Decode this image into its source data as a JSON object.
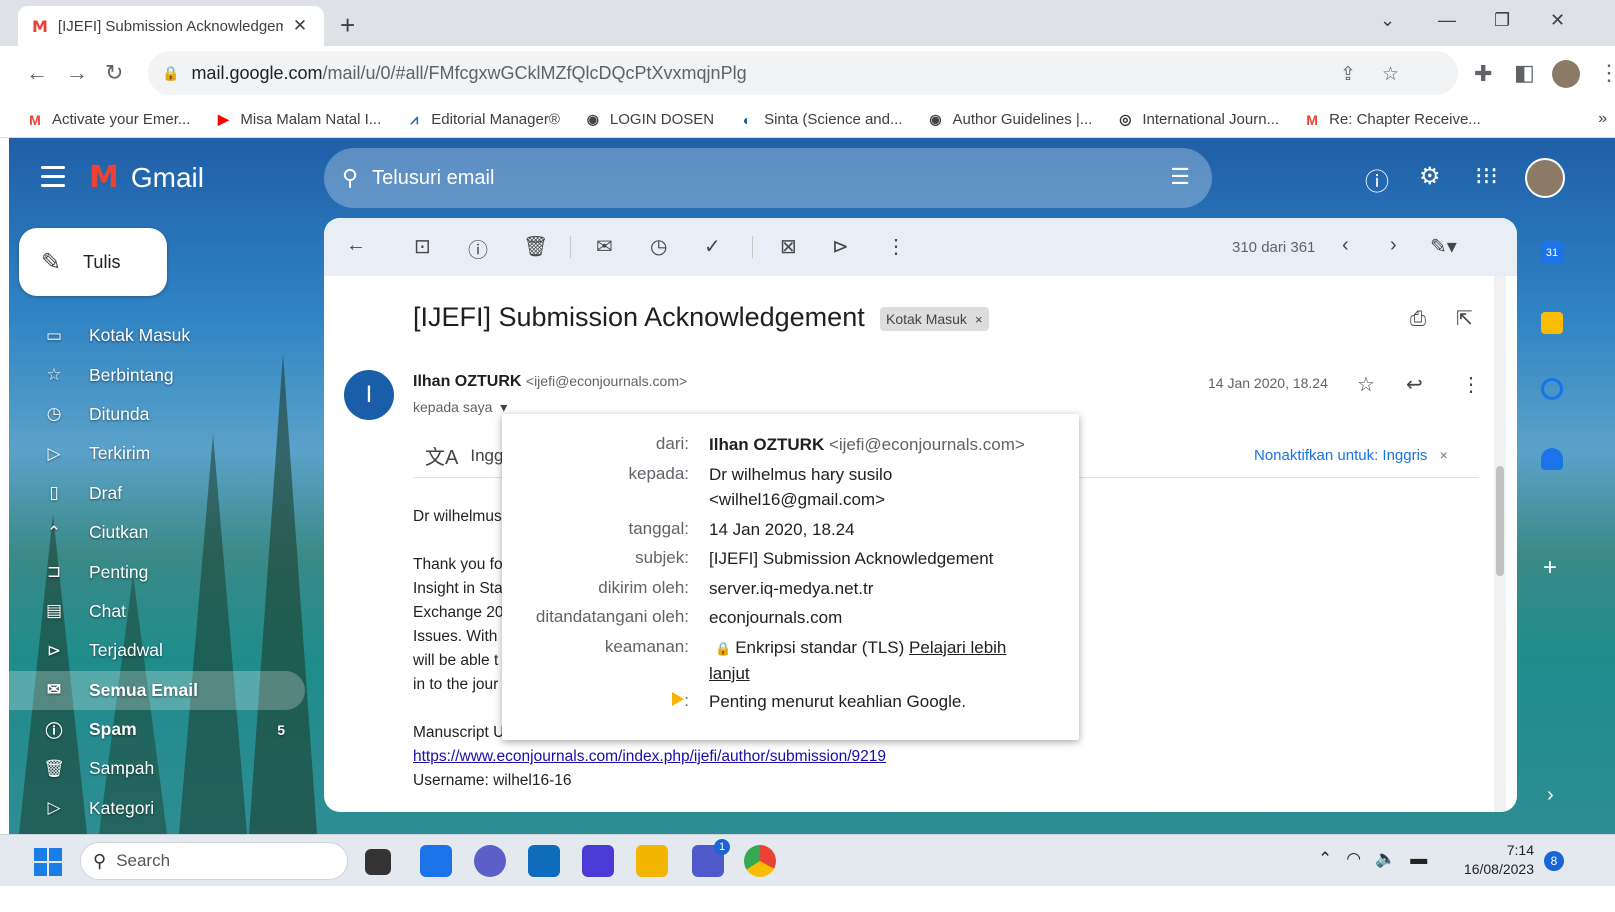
{
  "browser": {
    "tab_title": "[IJEFI] Submission Acknowledgement",
    "tab_close": "✕",
    "new_tab": "+",
    "url_host": "mail.google.com",
    "url_path": "/mail/u/0/#all/FMfcgxwGCklMZfQlcDQcPtXvxmqjnPlg",
    "bookmarks": [
      {
        "label": "Activate your Emer...",
        "icon": "gmail-icon"
      },
      {
        "label": "Misa Malam Natal I...",
        "icon": "youtube-icon"
      },
      {
        "label": "Editorial Manager®",
        "icon": "editorial-manager-icon"
      },
      {
        "label": "LOGIN DOSEN",
        "icon": "globe-icon"
      },
      {
        "label": "Sinta (Science and...",
        "icon": "sinta-icon"
      },
      {
        "label": "Author Guidelines |...",
        "icon": "globe-icon"
      },
      {
        "label": "International Journ...",
        "icon": "circle-icon"
      },
      {
        "label": "Re: Chapter Receive...",
        "icon": "gmail-icon"
      }
    ],
    "bookmarks_overflow": "»"
  },
  "gmail": {
    "brand": "Gmail",
    "search_placeholder": "Telusuri email",
    "compose_label": "Tulis",
    "nav": [
      {
        "label": "Kotak Masuk",
        "icon": "inbox-icon",
        "glyph": "▭"
      },
      {
        "label": "Berbintang",
        "icon": "star-icon",
        "glyph": "☆"
      },
      {
        "label": "Ditunda",
        "icon": "clock-icon",
        "glyph": "◷"
      },
      {
        "label": "Terkirim",
        "icon": "send-icon",
        "glyph": "▷"
      },
      {
        "label": "Draf",
        "icon": "draft-icon",
        "glyph": "▯"
      },
      {
        "label": "Ciutkan",
        "icon": "chevron-up-icon",
        "glyph": "⌃"
      },
      {
        "label": "Penting",
        "icon": "important-icon",
        "glyph": "⊐"
      },
      {
        "label": "Chat",
        "icon": "chat-icon",
        "glyph": "▤"
      },
      {
        "label": "Terjadwal",
        "icon": "scheduled-icon",
        "glyph": "⊳"
      },
      {
        "label": "Semua Email",
        "icon": "all-mail-icon",
        "glyph": "✉"
      },
      {
        "label": "Spam",
        "icon": "spam-icon",
        "glyph": "ⓘ",
        "count": "5"
      },
      {
        "label": "Sampah",
        "icon": "trash-icon",
        "glyph": "🗑"
      },
      {
        "label": "Kategori",
        "icon": "label-icon",
        "glyph": "▷"
      }
    ],
    "message_count": "310 dari 361",
    "subject": "[IJEFI] Submission Acknowledgement",
    "label_chip": "Kotak Masuk",
    "label_chip_close": "×",
    "sender_initial": "I",
    "sender_name": "Ilhan OZTURK",
    "sender_email": "<ijefi@econjournals.com>",
    "to_me": "kepada saya",
    "date": "14 Jan 2020, 18.24",
    "translate_lang": "Inggr",
    "translate_off": "Nonaktifkan untuk: Inggris",
    "translate_close": "×",
    "body_lines": [
      "Dr wilhelmus",
      "Thank you fo",
      "Insight in Sta",
      "Exchange 20",
      "Issues. With",
      "will be able t",
      "in to the jour",
      "Manuscript U"
    ],
    "body_link": "https://www.econjournals.com/index.php/ijefi/author/submission/9219",
    "body_username": "Username: wilhel16-16"
  },
  "details_popup": {
    "from_key": "dari:",
    "from_name": "Ilhan OZTURK",
    "from_email": "<ijefi@econjournals.com>",
    "to_key": "kepada:",
    "to_value_1": "Dr wilhelmus hary susilo",
    "to_value_2": "<wilhel16@gmail.com>",
    "date_key": "tanggal:",
    "date_value": "14 Jan 2020, 18.24",
    "subject_key": "subjek:",
    "subject_value": "[IJEFI] Submission Acknowledgement",
    "mailed_by_key": "dikirim oleh:",
    "mailed_by_value": "server.iq-medya.net.tr",
    "signed_by_key": "ditandatangani oleh:",
    "signed_by_value": "econjournals.com",
    "security_key": "keamanan:",
    "security_value": "Enkripsi standar (TLS)",
    "security_link_1": "Pelajari lebih",
    "security_link_2": "lanjut",
    "importance_key": ":",
    "importance_value": "Penting menurut keahlian Google."
  },
  "taskbar": {
    "search_label": "Search",
    "teams_badge": "1",
    "time": "7:14",
    "date": "16/08/2023",
    "notification_count": "8"
  },
  "colors": {
    "gmail_red": "#ea4335",
    "accent_blue": "#1a73e8",
    "avatar_blue": "#1a5da8",
    "important_yellow": "#f4b400"
  }
}
